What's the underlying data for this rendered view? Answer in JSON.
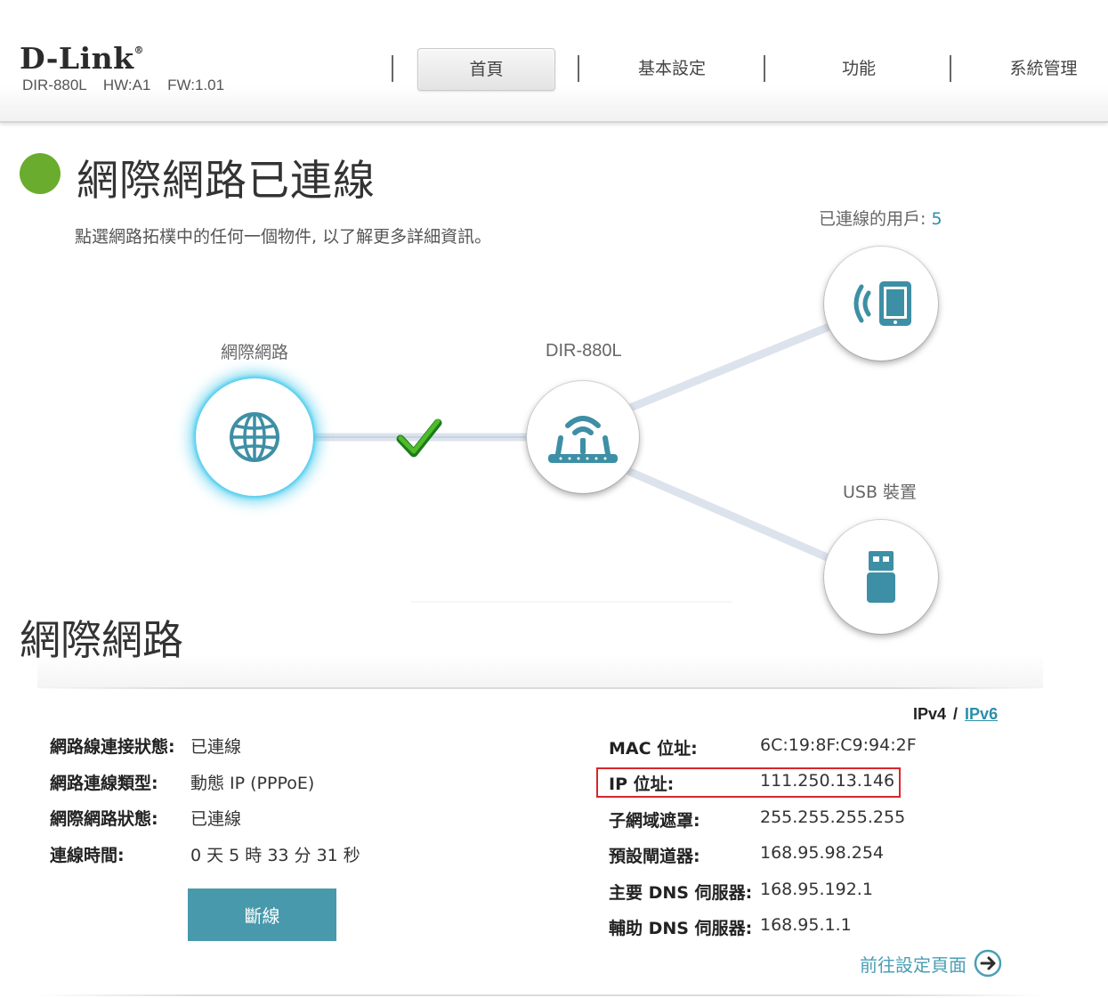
{
  "header": {
    "brand": "D-Link",
    "brand_mark": "®",
    "model_info": "DIR-880L   HW:A1   FW:1.01",
    "nav": [
      {
        "label": "首頁",
        "active": true
      },
      {
        "label": "基本設定",
        "active": false
      },
      {
        "label": "功能",
        "active": false
      },
      {
        "label": "系統管理",
        "active": false
      }
    ]
  },
  "status": {
    "title": "網際網路已連線",
    "hint": "點選網路拓樸中的任何一個物件, 以了解更多詳細資訊。",
    "indicator_color": "#6aac2d"
  },
  "topology": {
    "internet_label": "網際網路",
    "router_label": "DIR-880L",
    "clients_label": "已連線的用戶: ",
    "clients_count": "5",
    "usb_label": "USB 裝置",
    "icons": {
      "internet": "globe-icon",
      "router": "router-icon",
      "clients": "wireless-tablet-icon",
      "usb": "usb-drive-icon",
      "link": "checkmark-icon"
    },
    "accent_color": "#3d8fa5"
  },
  "section": {
    "title": "網際網路",
    "ip_switch": {
      "ipv4": "IPv4",
      "sep": "/",
      "ipv6": "IPv6"
    },
    "left": [
      {
        "key": "網路線連接狀態:",
        "value": "已連線"
      },
      {
        "key": "網路連線類型:",
        "value": "動態 IP (PPPoE)"
      },
      {
        "key": "網際網路狀態:",
        "value": "已連線"
      },
      {
        "key": "連線時間:",
        "value": "0 天 5 時 33 分 31 秒"
      }
    ],
    "right": [
      {
        "key": "MAC 位址:",
        "value": "6C:19:8F:C9:94:2F"
      },
      {
        "key": "IP 位址:",
        "value": "111.250.13.146"
      },
      {
        "key": "子網域遮罩:",
        "value": "255.255.255.255"
      },
      {
        "key": "預設閘道器:",
        "value": "168.95.98.254"
      },
      {
        "key": "主要 DNS 伺服器:",
        "value": "168.95.192.1"
      },
      {
        "key": "輔助 DNS 伺服器:",
        "value": "168.95.1.1"
      }
    ],
    "disconnect_label": "斷線",
    "goto_label": "前往設定頁面",
    "highlight_color": "#d9262c"
  }
}
